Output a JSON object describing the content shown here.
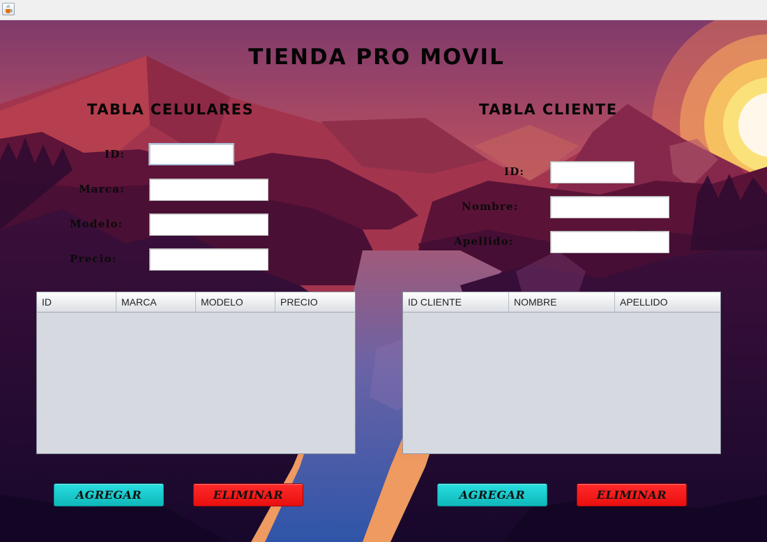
{
  "window": {
    "icon": "java-cup-icon"
  },
  "app": {
    "title": "TIENDA PRO MOVIL"
  },
  "celulares": {
    "title": "TABLA CELULARES",
    "labels": {
      "id": "ID:",
      "marca": "Marca:",
      "modelo": "Modelo:",
      "precio": "Precio:"
    },
    "values": {
      "id": "",
      "marca": "",
      "modelo": "",
      "precio": ""
    },
    "columns": [
      "ID",
      "MARCA",
      "MODELO",
      "PRECIO"
    ],
    "rows": [],
    "buttons": {
      "add": "AGREGAR",
      "delete": "ELIMINAR"
    }
  },
  "cliente": {
    "title": "TABLA CLIENTE",
    "labels": {
      "id": "ID:",
      "nombre": "Nombre:",
      "apellido": "Apellido:"
    },
    "values": {
      "id": "",
      "nombre": "",
      "apellido": ""
    },
    "columns": [
      "ID CLIENTE",
      "NOMBRE",
      "APELLIDO"
    ],
    "rows": [],
    "buttons": {
      "add": "AGREGAR",
      "delete": "ELIMINAR"
    }
  },
  "colors": {
    "add_button": "#1ccfd2",
    "delete_button": "#ff1a1a",
    "table_background": "#d6d9e0",
    "heading_text": "#050505"
  }
}
